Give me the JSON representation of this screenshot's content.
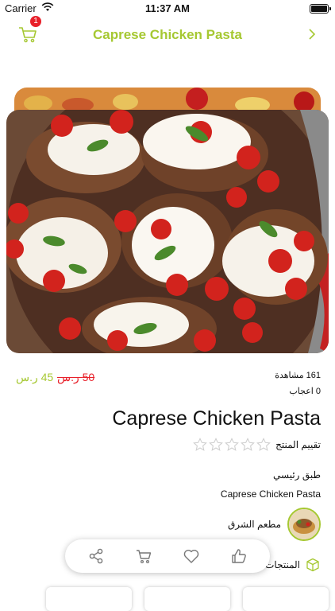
{
  "status": {
    "carrier": "Carrier",
    "time": "11:37 AM"
  },
  "header": {
    "title": "Caprese Chicken Pasta",
    "cart_badge": "1"
  },
  "product": {
    "price_new": "45 ر.س",
    "price_old": "50 ر.س",
    "views": "161 مشاهدة",
    "likes": "0 اعجاب",
    "name": "Caprese Chicken Pasta",
    "rating_label": "تقييم المنتج",
    "rating_value": 0,
    "rating_max": 5,
    "category": "طبق رئيسي",
    "subtitle": "Caprese Chicken Pasta",
    "restaurant": "مطعم الشرق",
    "related_label": "المنتجات ا"
  },
  "colors": {
    "accent": "#a6c832",
    "badge": "#e8202a",
    "old_price": "#e8202a"
  },
  "action_bar": [
    "share-icon",
    "cart-icon",
    "heart-icon",
    "thumbs-up-icon"
  ]
}
